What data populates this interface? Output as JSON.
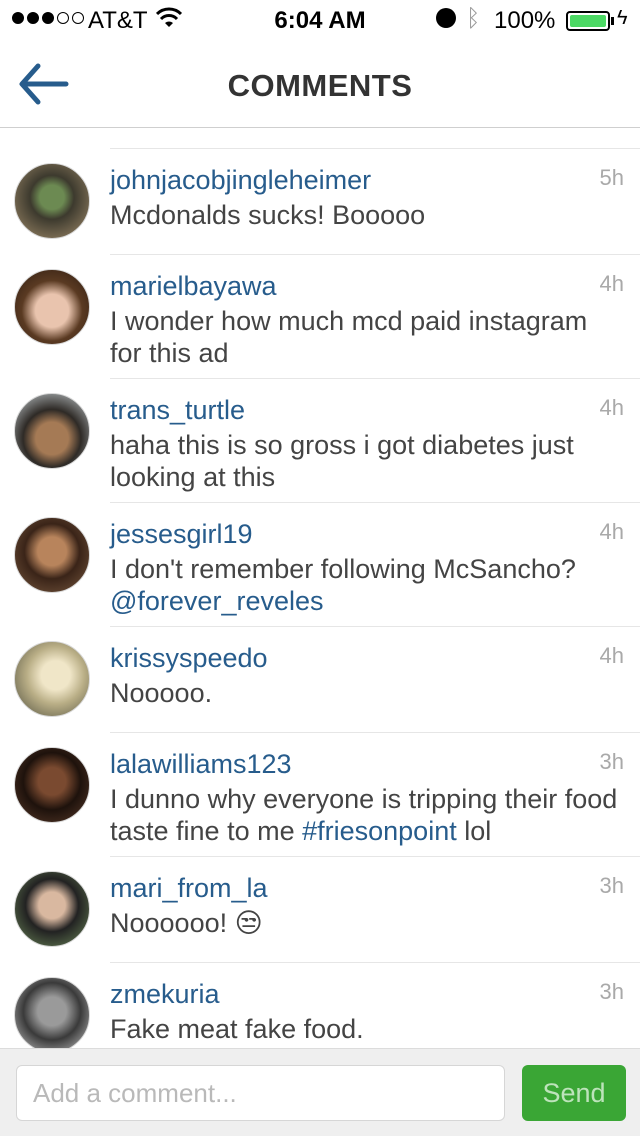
{
  "status_bar": {
    "carrier": "AT&T",
    "time": "6:04 AM",
    "battery": "100%",
    "signal_bars": 3,
    "signal_total": 5,
    "icons": [
      "wifi-icon",
      "alarm-icon",
      "bluetooth-icon",
      "battery-icon",
      "charging-icon"
    ]
  },
  "nav": {
    "title": "COMMENTS",
    "back_icon": "back-arrow-icon"
  },
  "comments": [
    {
      "username": "johnjacobjingleheimer",
      "time": "5h",
      "text": "Mcdonalds sucks! Booooo"
    },
    {
      "username": "marielbayawa",
      "time": "4h",
      "text": "I wonder how much mcd paid instagram for this ad"
    },
    {
      "username": "trans_turtle",
      "time": "4h",
      "text": "haha this is so gross i got diabetes just looking at this"
    },
    {
      "username": "jessesgirl19",
      "time": "4h",
      "text": "I don't remember following McSancho?",
      "mention": "@forever_reveles"
    },
    {
      "username": "krissyspeedo",
      "time": "4h",
      "text": "Nooooo."
    },
    {
      "username": "lalawilliams123",
      "time": "3h",
      "text_before": "I dunno why everyone is tripping their food taste fine to me ",
      "hashtag": "#friesonpoint",
      "text_after": " lol"
    },
    {
      "username": "mari_from_la",
      "time": "3h",
      "text": "Noooooo! 😒"
    },
    {
      "username": "zmekuria",
      "time": "3h",
      "text": "Fake meat fake food."
    }
  ],
  "input": {
    "placeholder": "Add a comment...",
    "value": "",
    "send_label": "Send"
  },
  "colors": {
    "link": "#275c8c",
    "send_button": "#3aa635",
    "battery": "#4cd964"
  }
}
